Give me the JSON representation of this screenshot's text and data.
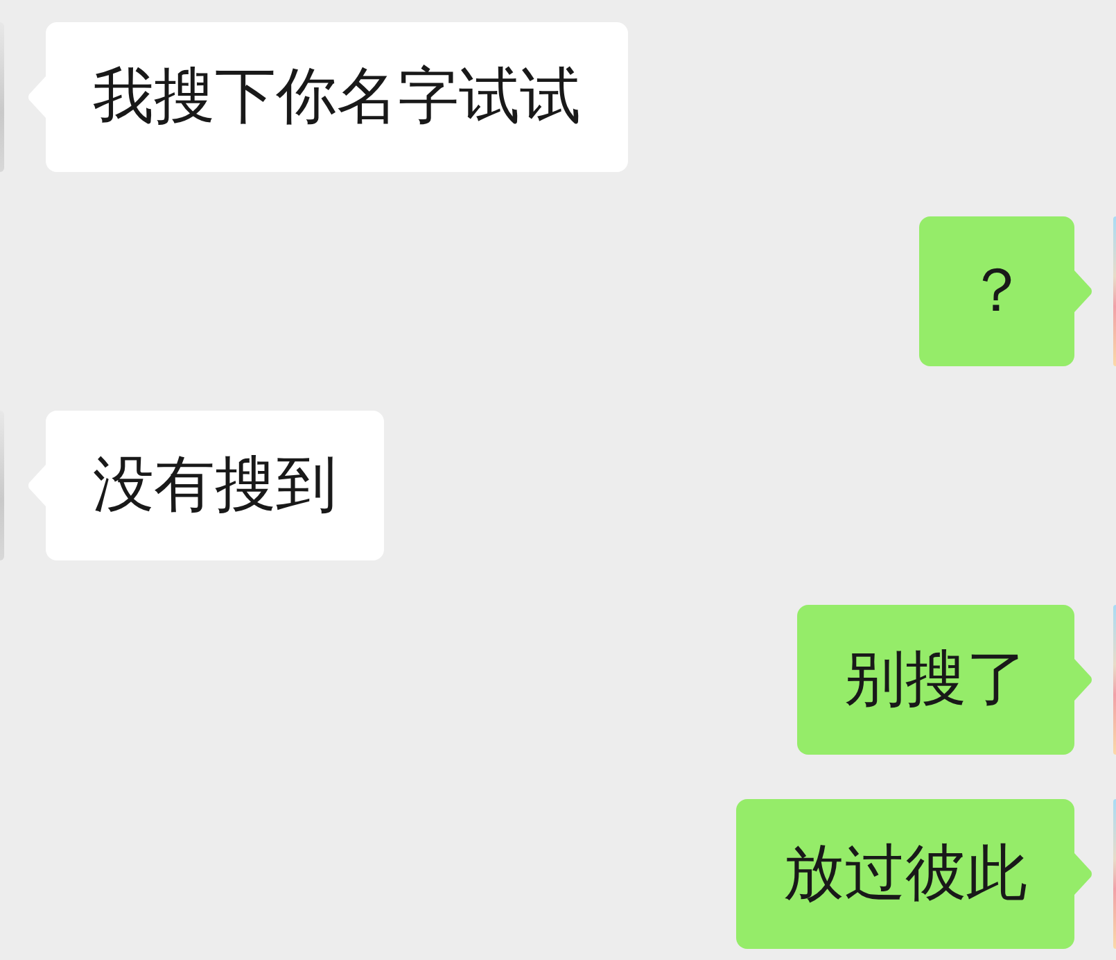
{
  "messages": [
    {
      "kind": "incoming",
      "text": "我搜下你名字试试"
    },
    {
      "kind": "outgoing",
      "text": "？"
    },
    {
      "kind": "incoming",
      "text": "没有搜到"
    },
    {
      "kind": "outgoing",
      "text": "别搜了"
    },
    {
      "kind": "outgoing",
      "text": "放过彼此"
    }
  ]
}
